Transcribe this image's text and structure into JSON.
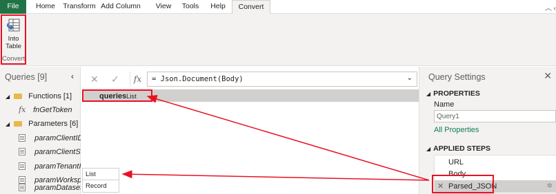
{
  "tabs": [
    "File",
    "Home",
    "Transform",
    "Add Column",
    "View",
    "Tools",
    "Help",
    "Convert"
  ],
  "active_tab": "Convert",
  "ribbon": {
    "into_table_line1": "Into",
    "into_table_line2": "Table",
    "group_label": "Convert"
  },
  "queries_pane": {
    "title": "Queries [9]",
    "tree": [
      {
        "label": "Functions [1]",
        "kind": "folder"
      },
      {
        "label": "fnGetToken",
        "kind": "function"
      },
      {
        "label": "Parameters [6]",
        "kind": "folder"
      },
      {
        "label": "paramClientID...",
        "kind": "parameter"
      },
      {
        "label": "paramClientSe...",
        "kind": "parameter"
      },
      {
        "label": "paramTenantI...",
        "kind": "parameter"
      },
      {
        "label": "paramWorksp...",
        "kind": "parameter"
      },
      {
        "label": "paramDatasetI...",
        "kind": "parameter"
      }
    ]
  },
  "formula_bar": {
    "formula": "= Json.Document(Body)"
  },
  "grid": {
    "column_name": "queries",
    "column_type": "List",
    "cell_list": "List",
    "cell_record": "Record"
  },
  "query_settings": {
    "title": "Query Settings",
    "properties_title": "PROPERTIES",
    "name_label": "Name",
    "name_value": "Query1",
    "all_properties": "All Properties",
    "applied_steps_title": "APPLIED STEPS",
    "steps": [
      "URL",
      "Body",
      "Parsed_JSON"
    ]
  },
  "colors": {
    "file_tab": "#217346",
    "annotation_red": "#e81123",
    "link_green": "#0e7a5a"
  }
}
